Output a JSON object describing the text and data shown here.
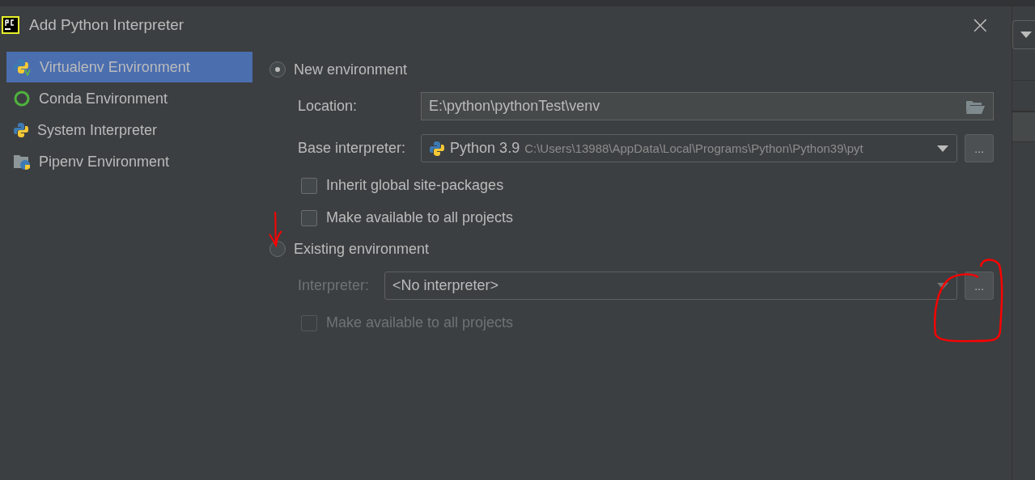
{
  "window": {
    "title": "Add Python Interpreter",
    "close_button": "×"
  },
  "sidebar": {
    "items": [
      {
        "label": "Virtualenv Environment",
        "selected": true
      },
      {
        "label": "Conda Environment",
        "selected": false
      },
      {
        "label": "System Interpreter",
        "selected": false
      },
      {
        "label": "Pipenv Environment",
        "selected": false
      }
    ]
  },
  "options": [
    {
      "label": "New environment",
      "selected": true,
      "fields": [
        {
          "kind": "path",
          "label": "Location:",
          "value": "E:\\python\\pythonTest\\venv"
        },
        {
          "kind": "select",
          "label": "Base interpreter:",
          "value": "Python 3.9",
          "detail": "C:\\Users\\13988\\AppData\\Local\\Programs\\Python\\Python39\\pyt",
          "browse_button": "..."
        }
      ],
      "checkboxes": [
        {
          "label": "Inherit global site-packages",
          "checked": false
        },
        {
          "label": "Make available to all projects",
          "checked": false
        }
      ]
    },
    {
      "label": "Existing environment",
      "selected": false,
      "fields": [
        {
          "kind": "select",
          "label": "Interpreter:",
          "value": "<No interpreter>",
          "browse_button": "..."
        }
      ],
      "checkboxes": [
        {
          "label": "Make available to all projects",
          "checked": false
        }
      ]
    }
  ]
}
